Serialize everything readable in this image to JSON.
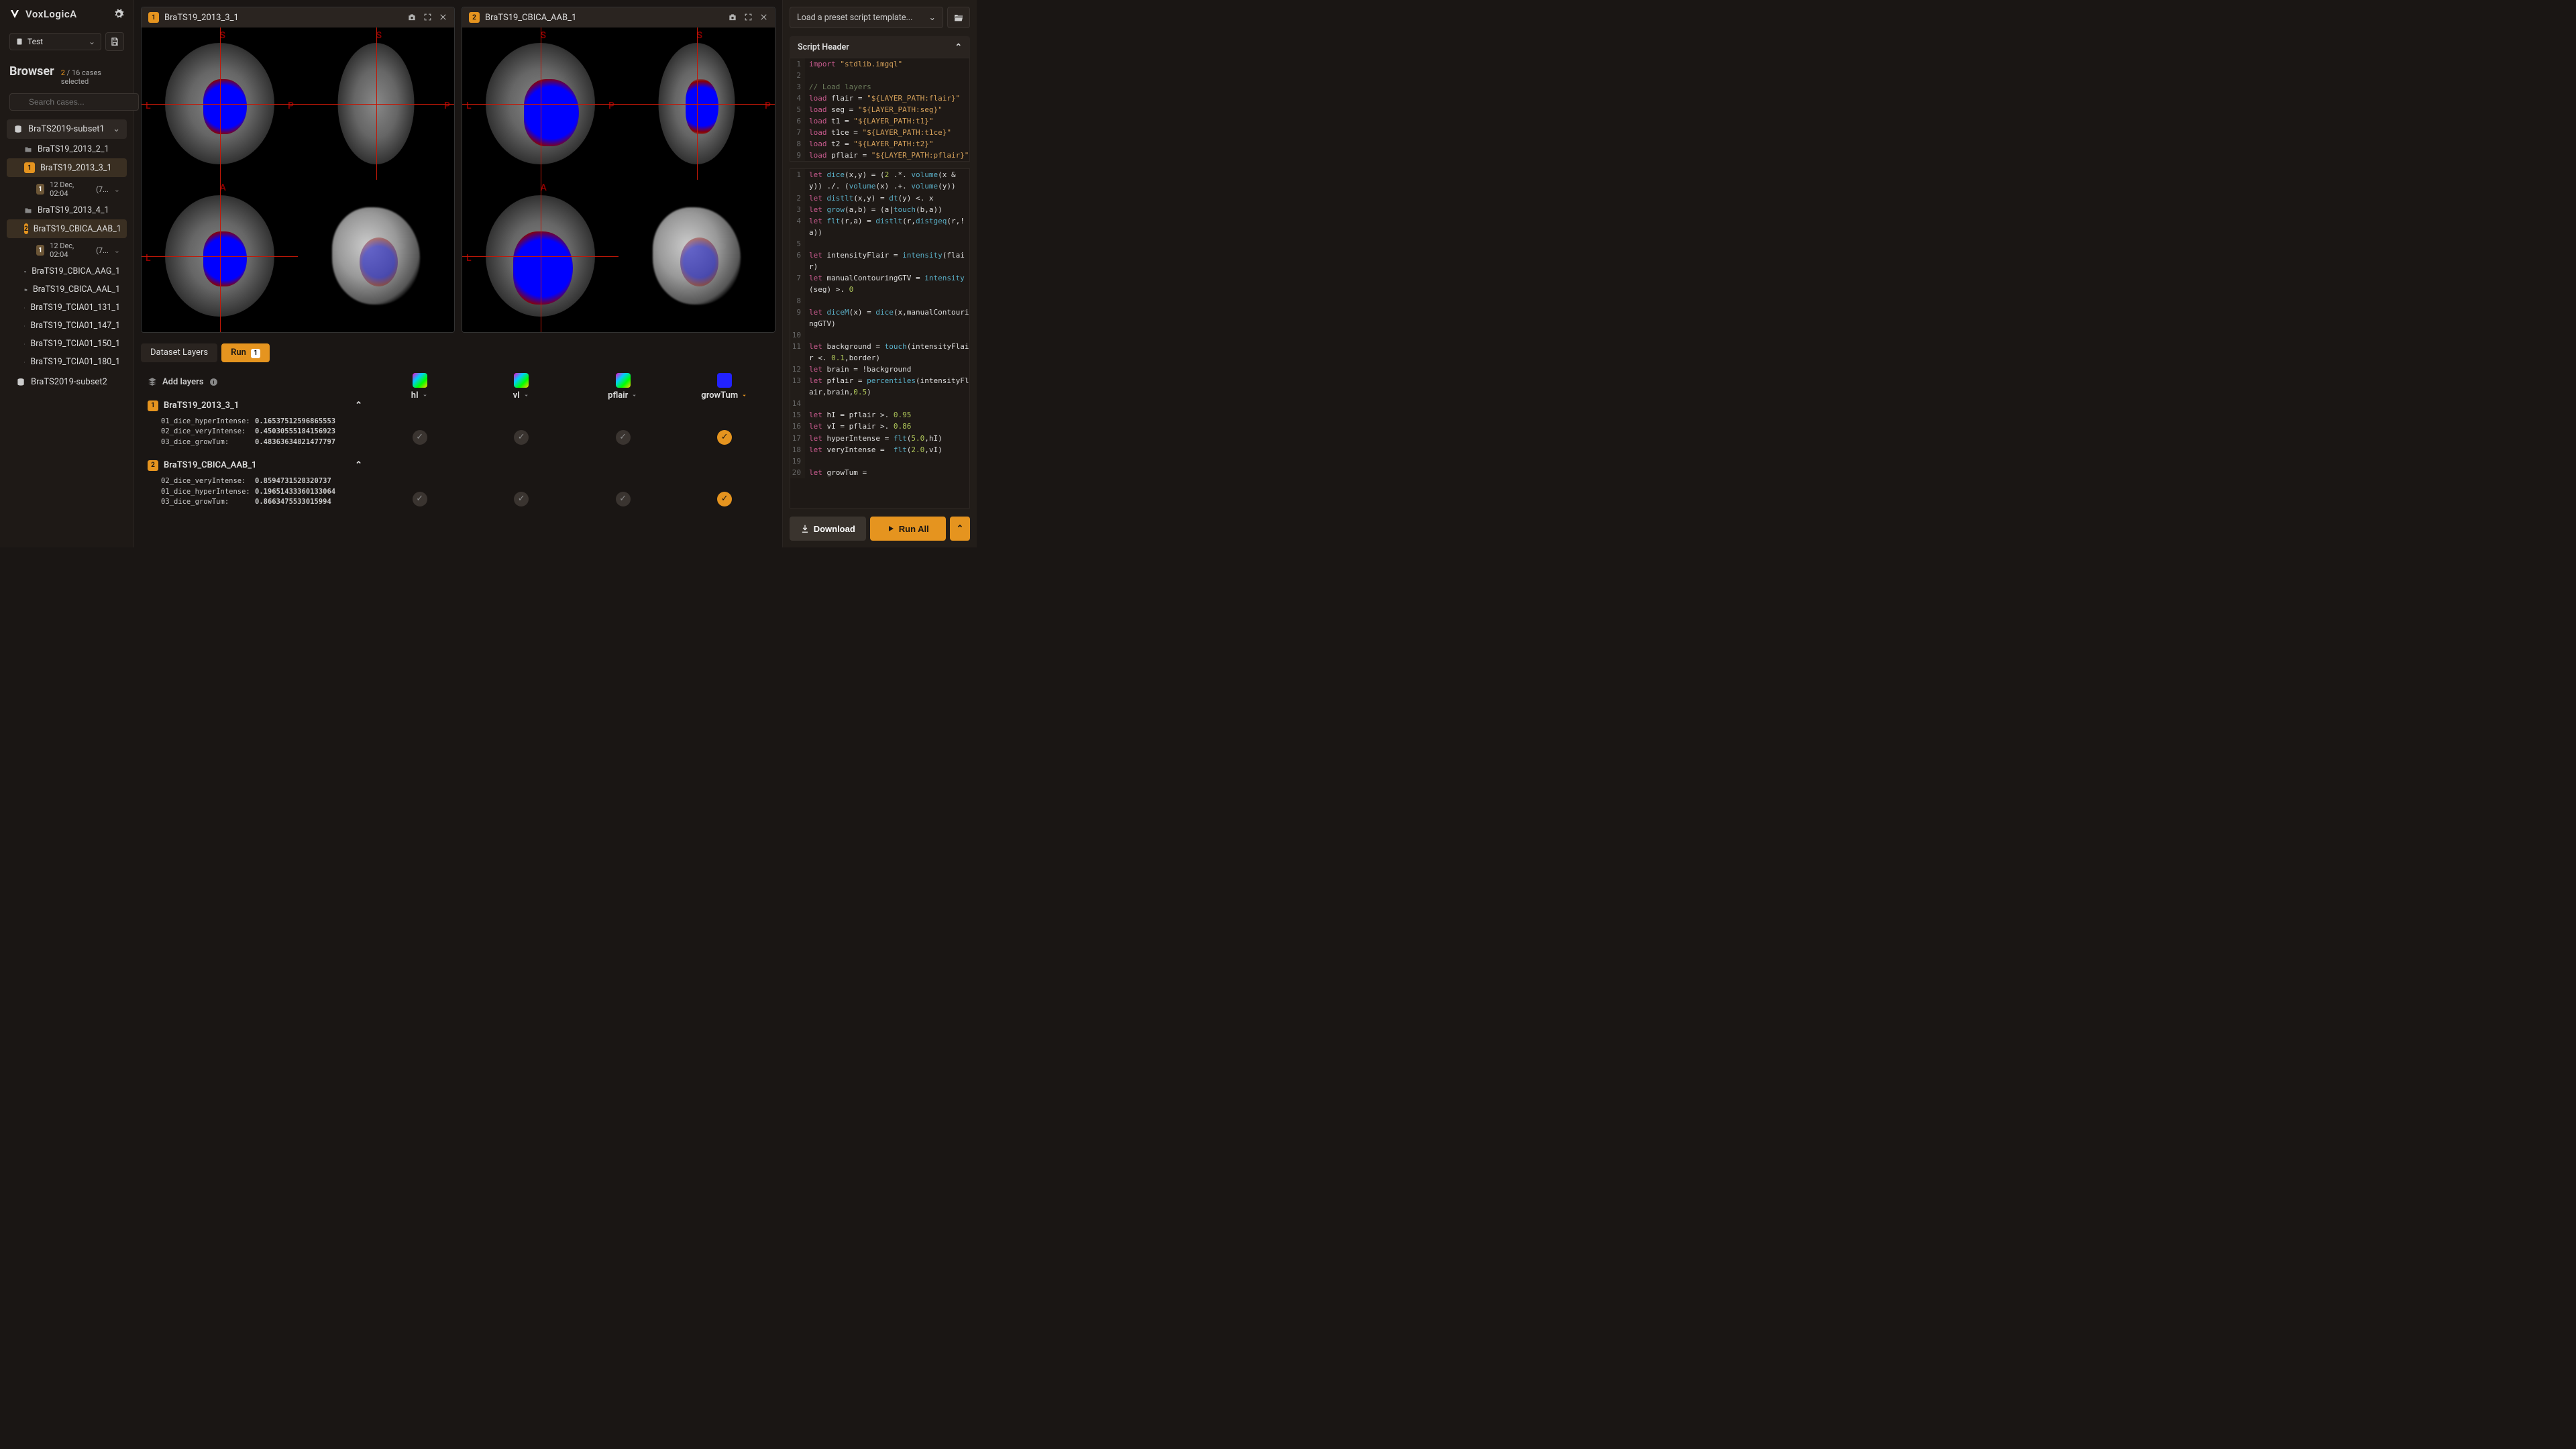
{
  "brand": {
    "name": "VoxLogicA"
  },
  "workspace": {
    "name": "Test"
  },
  "browser": {
    "title": "Browser",
    "selected": "2",
    "total": "16 cases selected",
    "search_placeholder": "Search cases...",
    "datasets": [
      {
        "name": "BraTS2019-subset1",
        "open": true,
        "cases": [
          {
            "name": "BraTS19_2013_2_1"
          },
          {
            "name": "BraTS19_2013_3_1",
            "badge": "1",
            "run": {
              "badge": "1",
              "ts": "12 Dec, 02:04",
              "extra": "(7..."
            }
          },
          {
            "name": "BraTS19_2013_4_1"
          },
          {
            "name": "BraTS19_CBICA_AAB_1",
            "badge": "2",
            "run": {
              "badge": "1",
              "ts": "12 Dec, 02:04",
              "extra": "(7..."
            }
          },
          {
            "name": "BraTS19_CBICA_AAG_1"
          },
          {
            "name": "BraTS19_CBICA_AAL_1"
          },
          {
            "name": "BraTS19_TCIA01_131_1"
          },
          {
            "name": "BraTS19_TCIA01_147_1"
          },
          {
            "name": "BraTS19_TCIA01_150_1"
          },
          {
            "name": "BraTS19_TCIA01_180_1"
          }
        ]
      },
      {
        "name": "BraTS2019-subset2",
        "open": false
      }
    ]
  },
  "viewers": [
    {
      "badge": "1",
      "title": "BraTS19_2013_3_1"
    },
    {
      "badge": "2",
      "title": "BraTS19_CBICA_AAB_1"
    }
  ],
  "tabs": {
    "dataset": "Dataset Layers",
    "run": "Run",
    "run_badge": "1"
  },
  "layers": {
    "add_label": "Add layers",
    "cols": [
      {
        "name": "hI"
      },
      {
        "name": "vI"
      },
      {
        "name": "pflair"
      },
      {
        "name": "growTum",
        "sel": true
      }
    ],
    "cases": [
      {
        "badge": "1",
        "name": "BraTS19_2013_3_1",
        "metrics": [
          {
            "k": "01_dice_hyperIntense:",
            "v": "0.16537512596865553"
          },
          {
            "k": "02_dice_veryIntense:",
            "v": "0.45030555184156923"
          },
          {
            "k": "03_dice_growTum:",
            "v": "0.48363634821477797"
          }
        ],
        "toggles": [
          false,
          false,
          false,
          true
        ]
      },
      {
        "badge": "2",
        "name": "BraTS19_CBICA_AAB_1",
        "metrics": [
          {
            "k": "02_dice_veryIntense:",
            "v": "0.8594731528320737"
          },
          {
            "k": "01_dice_hyperIntense:",
            "v": "0.19651433360133064"
          },
          {
            "k": "03_dice_growTum:",
            "v": "0.8663475533015994"
          }
        ],
        "toggles": [
          false,
          false,
          false,
          true
        ]
      }
    ]
  },
  "script": {
    "preset_placeholder": "Load a preset script template...",
    "header_label": "Script Header",
    "header_lines": [
      [
        [
          "kw",
          "import "
        ],
        [
          "str",
          "\"stdlib.imgql\""
        ]
      ],
      [
        [
          "",
          "  "
        ]
      ],
      [
        [
          "cm",
          "// Load layers"
        ]
      ],
      [
        [
          "kw",
          "load"
        ],
        [
          "",
          " flair = "
        ],
        [
          "str",
          "\"${LAYER_PATH:flair}\""
        ]
      ],
      [
        [
          "kw",
          "load"
        ],
        [
          "",
          " seg = "
        ],
        [
          "str",
          "\"${LAYER_PATH:seg}\""
        ]
      ],
      [
        [
          "kw",
          "load"
        ],
        [
          "",
          " t1 = "
        ],
        [
          "str",
          "\"${LAYER_PATH:t1}\""
        ]
      ],
      [
        [
          "kw",
          "load"
        ],
        [
          "",
          " t1ce = "
        ],
        [
          "str",
          "\"${LAYER_PATH:t1ce}\""
        ]
      ],
      [
        [
          "kw",
          "load"
        ],
        [
          "",
          " t2 = "
        ],
        [
          "str",
          "\"${LAYER_PATH:t2}\""
        ]
      ],
      [
        [
          "kw",
          "load"
        ],
        [
          "",
          " pflair = "
        ],
        [
          "str",
          "\"${LAYER_PATH:pflair}\""
        ]
      ]
    ],
    "body_lines": [
      [
        [
          "kw",
          "let"
        ],
        [
          "",
          " "
        ],
        [
          "fn",
          "dice"
        ],
        [
          "",
          "(x,y) = ("
        ],
        [
          "num",
          "2"
        ],
        [
          "",
          " .*. "
        ],
        [
          "fn",
          "volume"
        ],
        [
          "",
          "(x & y)) ./. ("
        ],
        [
          "fn",
          "volume"
        ],
        [
          "",
          "(x) .+. "
        ],
        [
          "fn",
          "volume"
        ],
        [
          "",
          "(y))"
        ]
      ],
      [
        [
          "kw",
          "let"
        ],
        [
          "",
          " "
        ],
        [
          "fn",
          "distlt"
        ],
        [
          "",
          "(x,y) = "
        ],
        [
          "fn",
          "dt"
        ],
        [
          "",
          "(y) <. x"
        ]
      ],
      [
        [
          "kw",
          "let"
        ],
        [
          "",
          " "
        ],
        [
          "fn",
          "grow"
        ],
        [
          "",
          "(a,b) = (a|"
        ],
        [
          "fn",
          "touch"
        ],
        [
          "",
          "(b,a))"
        ]
      ],
      [
        [
          "kw",
          "let"
        ],
        [
          "",
          " "
        ],
        [
          "fn",
          "flt"
        ],
        [
          "",
          "(r,a) = "
        ],
        [
          "fn",
          "distlt"
        ],
        [
          "",
          "(r,"
        ],
        [
          "fn",
          "distgeq"
        ],
        [
          "",
          "(r,!a))"
        ]
      ],
      [
        [
          "",
          "  "
        ]
      ],
      [
        [
          "kw",
          "let"
        ],
        [
          "",
          " intensityFlair = "
        ],
        [
          "fn",
          "intensity"
        ],
        [
          "",
          "(flair)"
        ]
      ],
      [
        [
          "kw",
          "let"
        ],
        [
          "",
          " manualContouringGTV = "
        ],
        [
          "fn",
          "intensity"
        ],
        [
          "",
          "(seg) >. "
        ],
        [
          "num",
          "0"
        ]
      ],
      [
        [
          "",
          "  "
        ]
      ],
      [
        [
          "kw",
          "let"
        ],
        [
          "",
          " "
        ],
        [
          "fn",
          "diceM"
        ],
        [
          "",
          "(x) = "
        ],
        [
          "fn",
          "dice"
        ],
        [
          "",
          "(x,manualContouringGTV)"
        ]
      ],
      [
        [
          "",
          "  "
        ]
      ],
      [
        [
          "kw",
          "let"
        ],
        [
          "",
          " background = "
        ],
        [
          "fn",
          "touch"
        ],
        [
          "",
          "(intensityFlair <. "
        ],
        [
          "num",
          "0.1"
        ],
        [
          "",
          ",border)"
        ]
      ],
      [
        [
          "kw",
          "let"
        ],
        [
          "",
          " brain = !background"
        ]
      ],
      [
        [
          "kw",
          "let"
        ],
        [
          "",
          " pflair = "
        ],
        [
          "fn",
          "percentiles"
        ],
        [
          "",
          "(intensityFlair,brain,"
        ],
        [
          "num",
          "0.5"
        ],
        [
          "",
          ")"
        ]
      ],
      [
        [
          "",
          "  "
        ]
      ],
      [
        [
          "kw",
          "let"
        ],
        [
          "",
          " hI = pflair >. "
        ],
        [
          "num",
          "0.95"
        ]
      ],
      [
        [
          "kw",
          "let"
        ],
        [
          "",
          " vI = pflair >. "
        ],
        [
          "num",
          "0.86"
        ]
      ],
      [
        [
          "kw",
          "let"
        ],
        [
          "",
          " hyperIntense = "
        ],
        [
          "fn",
          "flt"
        ],
        [
          "",
          "("
        ],
        [
          "num",
          "5.0"
        ],
        [
          "",
          ",hI)"
        ]
      ],
      [
        [
          "kw",
          "let"
        ],
        [
          "",
          " veryIntense =  "
        ],
        [
          "fn",
          "flt"
        ],
        [
          "",
          "("
        ],
        [
          "num",
          "2.0"
        ],
        [
          "",
          ",vI)"
        ]
      ],
      [
        [
          "",
          "  "
        ]
      ],
      [
        [
          "kw",
          "let"
        ],
        [
          "",
          " growTum ="
        ]
      ]
    ],
    "download": "Download",
    "run_all": "Run All"
  }
}
